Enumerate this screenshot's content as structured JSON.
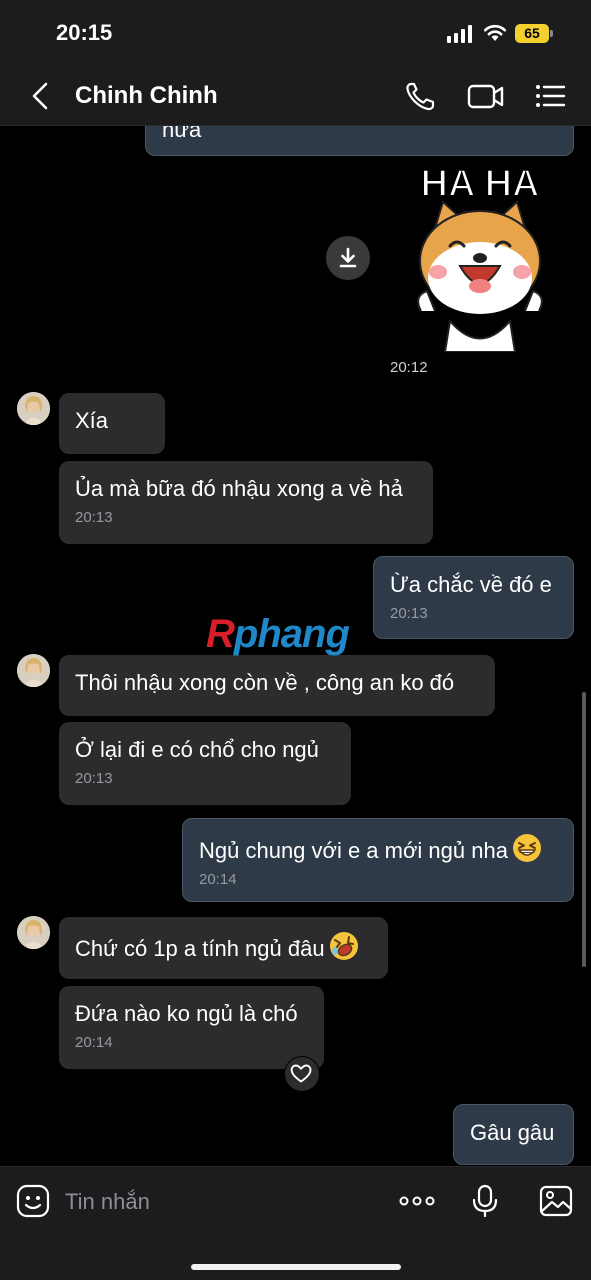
{
  "status_bar": {
    "time": "20:15",
    "battery": "65"
  },
  "header": {
    "contact_name": "Chinh Chinh"
  },
  "messages": {
    "partial_out_text": "nữa",
    "sticker_caption": "HA HA",
    "sticker_time": "20:12",
    "m1": {
      "text": "Xía"
    },
    "m2": {
      "text": "Ủa mà bữa đó nhậu xong a về hả",
      "time": "20:13"
    },
    "m3": {
      "text": "Ừa chắc về đó e",
      "time": "20:13"
    },
    "m4": {
      "text": "Thôi nhậu xong còn về , công an ko đó"
    },
    "m5": {
      "text": "Ở lại đi e có chổ cho ngủ",
      "time": "20:13"
    },
    "m6": {
      "text": "Ngủ chung với e a mới ngủ nha",
      "time": "20:14"
    },
    "m7": {
      "text": "Chứ có 1p a tính ngủ đâu"
    },
    "m8": {
      "text": "Đứa nào ko ngủ là chó",
      "time": "20:14"
    },
    "m9": {
      "text": "Gâu gâu"
    }
  },
  "watermark": {
    "r": "R",
    "rest": "phang"
  },
  "composer": {
    "placeholder": "Tin nhắn"
  },
  "icons": {
    "back": "chevron-left-icon",
    "call": "phone-icon",
    "video": "video-camera-icon",
    "menu": "list-menu-icon",
    "download": "download-icon",
    "heart": "heart-icon",
    "sticker": "sticker-icon",
    "more": "more-dots-icon",
    "mic": "microphone-icon",
    "image": "image-icon",
    "emoji_grin": "grinning-squinting-emoji-icon",
    "emoji_laugh": "rolling-laughing-emoji-icon"
  },
  "colors": {
    "background": "#000000",
    "incoming_bubble": "#2c2c2e",
    "outgoing_bubble": "#2e3a48",
    "battery": "#f5d130"
  }
}
